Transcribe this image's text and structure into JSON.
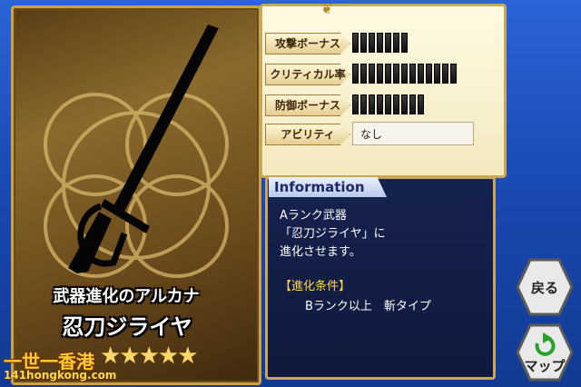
{
  "card": {
    "subtitle": "武器進化のアルカナ",
    "name": "忍刀ジライヤ",
    "stars": "★★★★★",
    "icon": "sword-icon"
  },
  "stats": [
    {
      "label": "攻撃ボーナス",
      "level": 7
    },
    {
      "label": "クリティカル率",
      "level": 13
    },
    {
      "label": "防御ボーナス",
      "level": 9
    }
  ],
  "ability": {
    "label": "アビリティ",
    "value": "なし"
  },
  "info": {
    "title": "Information",
    "lines": [
      "Aランク武器",
      "「忍刀ジライヤ」に",
      "進化させます。"
    ],
    "condition_title": "【進化条件】",
    "condition": "Bランク以上　斬タイプ"
  },
  "buttons": {
    "back": "戻る",
    "map": "マップ"
  },
  "watermark": {
    "line1": "一世一香港",
    "line2": "141hongkong.com"
  },
  "colors": {
    "gold": "#c9a75a",
    "info_bg": "#16224f",
    "condition": "#ffd84a"
  }
}
